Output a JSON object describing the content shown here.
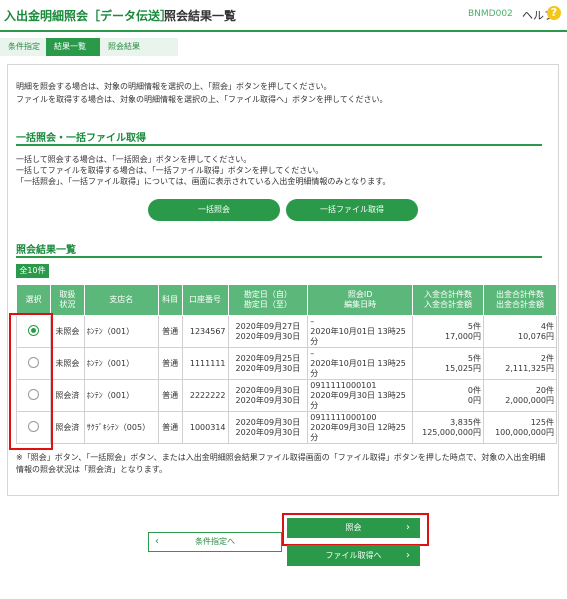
{
  "header": {
    "app_title": "入出金明細照会［データ伝送］",
    "page_title": "照会結果一覧",
    "screen_id": "BNMD002",
    "help_label": "ヘルプ",
    "help_icon": "?"
  },
  "steps": [
    "条件指定",
    "結果一覧",
    "照会結果"
  ],
  "intro": {
    "line1": "明細を照会する場合は、対象の明細情報を選択の上、「照会」ボタンを押してください。",
    "line2": "ファイルを取得する場合は、対象の明細情報を選択の上、「ファイル取得へ」ボタンを押してください。"
  },
  "bulk": {
    "title": "一括照会・一括ファイル取得",
    "line1": "一括して照会する場合は、「一括照会」ボタンを押してください。",
    "line2": "一括してファイルを取得する場合は、「一括ファイル取得」ボタンを押してください。",
    "line3": "「一括照会」、「一括ファイル取得」については、画面に表示されている入出金明細情報のみとなります。",
    "bulk_query_label": "一括照会",
    "bulk_file_label": "一括ファイル取得"
  },
  "results": {
    "title": "照会結果一覧",
    "count_badge": "全10件",
    "headers": {
      "select": "選択",
      "status": [
        "取扱",
        "状況"
      ],
      "branch": "支店名",
      "subject": "科目",
      "account": "口座番号",
      "period": [
        "勘定日（自）",
        "勘定日（至）"
      ],
      "inquiry": [
        "照会ID",
        "編集日時"
      ],
      "deposit": [
        "入金合計件数",
        "入金合計金額"
      ],
      "withdrawal": [
        "出金合計件数",
        "出金合計金額"
      ]
    },
    "rows": [
      {
        "selected": true,
        "status": "未照会",
        "branch": "ﾎﾝﾃﾝ（001）",
        "subject": "普通",
        "account": "1234567",
        "date_from": "2020年09月27日",
        "date_to": "2020年09月30日",
        "inquiry_id": "–",
        "edited": "2020年10月01日 13時25分",
        "dep_count": "5件",
        "dep_amount": "17,000円",
        "wd_count": "4件",
        "wd_amount": "10,076円"
      },
      {
        "selected": false,
        "status": "未照会",
        "branch": "ﾎﾝﾃﾝ（001）",
        "subject": "普通",
        "account": "1111111",
        "date_from": "2020年09月25日",
        "date_to": "2020年09月30日",
        "inquiry_id": "–",
        "edited": "2020年10月01日 13時25分",
        "dep_count": "5件",
        "dep_amount": "15,025円",
        "wd_count": "2件",
        "wd_amount": "2,111,325円"
      },
      {
        "selected": false,
        "status": "照会済",
        "branch": "ﾎﾝﾃﾝ（001）",
        "subject": "普通",
        "account": "2222222",
        "date_from": "2020年09月30日",
        "date_to": "2020年09月30日",
        "inquiry_id": "0911111000101",
        "edited": "2020年09月30日 13時25分",
        "dep_count": "0件",
        "dep_amount": "0円",
        "wd_count": "20件",
        "wd_amount": "2,000,000円"
      },
      {
        "selected": false,
        "status": "照会済",
        "branch": "ｻｸﾗﾞｷｼﾃﾝ（005）",
        "subject": "普通",
        "account": "1000314",
        "date_from": "2020年09月30日",
        "date_to": "2020年09月30日",
        "inquiry_id": "0911111000100",
        "edited": "2020年09月30日 12時25分",
        "dep_count": "3,835件",
        "dep_amount": "125,000,000円",
        "wd_count": "125件",
        "wd_amount": "100,000,000円"
      }
    ]
  },
  "note": {
    "line1": "※「照会」ボタン、「一括照会」ボタン、または入出金明細照会結果ファイル取得画面の「ファイル取得」ボタンを押した時点で、対象の入出金明細",
    "line2": "情報の照会状況は「照会済」となります。"
  },
  "footer": {
    "back_label": "条件指定へ",
    "query_label": "照会",
    "file_label": "ファイル取得へ",
    "chevron_left": "‹",
    "chevron_right": "›"
  },
  "colors": {
    "brand_green": "#2a9a4a",
    "header_green": "#5cb87a",
    "highlight_red": "#dd1111"
  }
}
